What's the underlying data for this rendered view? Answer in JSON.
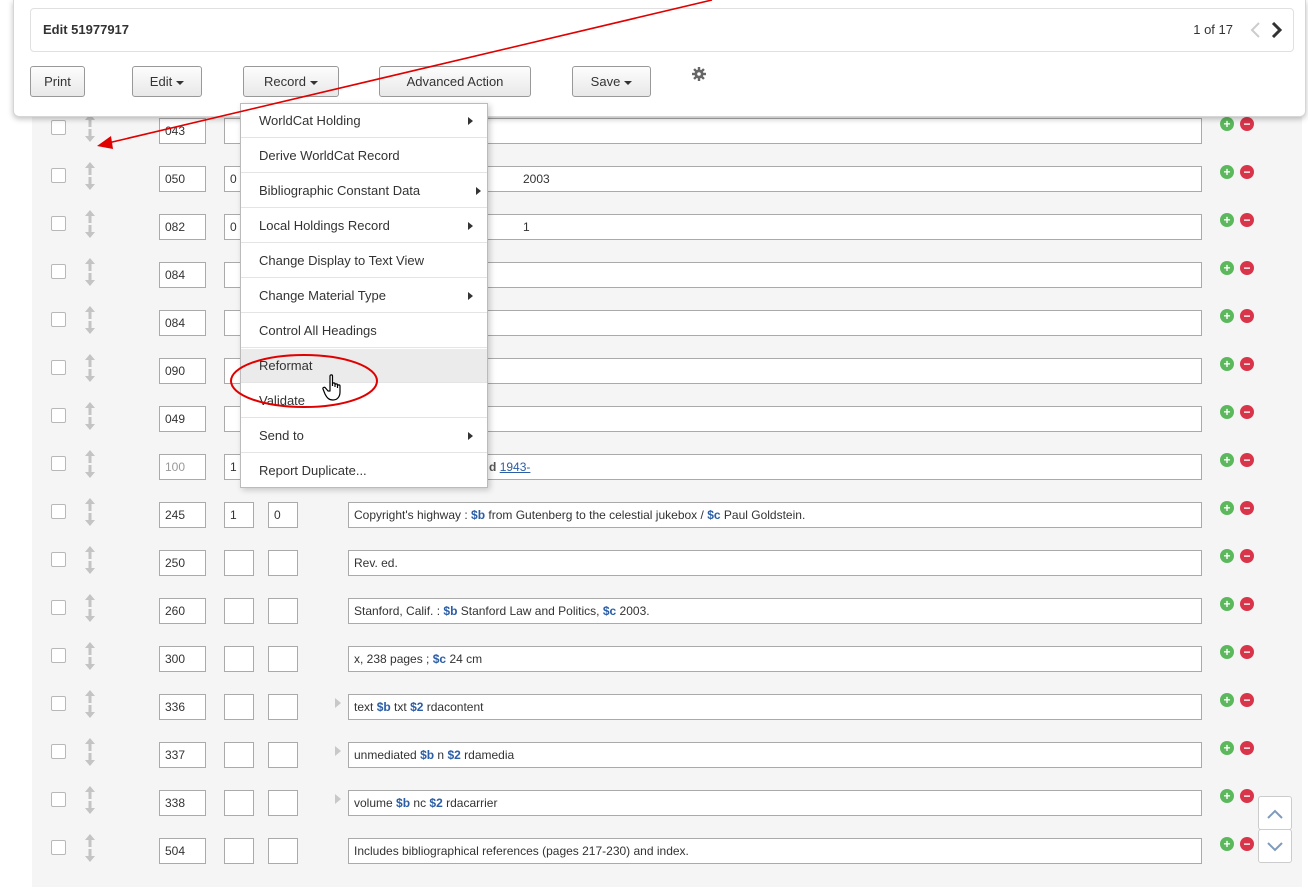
{
  "header": {
    "title": "Edit 51977917",
    "pager": "1 of 17",
    "prev_icon": "chevron-left-icon",
    "next_icon": "chevron-right-icon"
  },
  "toolbar": {
    "print": "Print",
    "edit": "Edit",
    "record": "Record",
    "advanced_action": "Advanced Action",
    "save": "Save",
    "settings_icon": "gear-icon"
  },
  "record_menu": {
    "items": [
      {
        "label": "WorldCat Holding",
        "submenu": true
      },
      {
        "label": "Derive WorldCat Record",
        "submenu": false
      },
      {
        "label": "Bibliographic Constant Data",
        "submenu": true
      },
      {
        "label": "Local Holdings Record",
        "submenu": true
      },
      {
        "label": "Change Display to Text View",
        "submenu": false
      },
      {
        "label": "Change Material Type",
        "submenu": true
      },
      {
        "label": "Control All Headings",
        "submenu": false
      },
      {
        "label": "Reformat",
        "submenu": false,
        "highlighted": true
      },
      {
        "label": "Validate",
        "submenu": false
      },
      {
        "label": "Send to",
        "submenu": true
      },
      {
        "label": "Report Duplicate...",
        "submenu": false
      }
    ]
  },
  "fields": [
    {
      "tag": "043",
      "ind1": "",
      "ind2": "",
      "text": ""
    },
    {
      "tag": "050",
      "ind1": "0",
      "ind2": "",
      "text": "2003"
    },
    {
      "tag": "082",
      "ind1": "0",
      "ind2": "",
      "text": "1"
    },
    {
      "tag": "084",
      "ind1": "",
      "ind2": "",
      "text": ""
    },
    {
      "tag": "084",
      "ind1": "",
      "ind2": "",
      "text": ""
    },
    {
      "tag": "090",
      "ind1": "",
      "ind2": "",
      "text": ""
    },
    {
      "tag": "049",
      "ind1": "",
      "ind2": "",
      "text": ""
    },
    {
      "tag": "100",
      "ind1": "1",
      "ind2": "",
      "text": "d",
      "link": "1943-"
    },
    {
      "tag": "245",
      "ind1": "1",
      "ind2": "0",
      "pre": "Copyright's highway :",
      "sub1": "$b",
      "mid": "from Gutenberg to the celestial jukebox /",
      "sub2": "$c",
      "post": "Paul Goldstein."
    },
    {
      "tag": "250",
      "ind1": "",
      "ind2": "",
      "text": "Rev. ed."
    },
    {
      "tag": "260",
      "ind1": "",
      "ind2": "",
      "pre": "Stanford, Calif. :",
      "sub1": "$b",
      "mid": "Stanford Law and Politics,",
      "sub2": "$c",
      "post": "2003."
    },
    {
      "tag": "300",
      "ind1": "",
      "ind2": "",
      "pre": "x, 238 pages ;",
      "sub1": "$c",
      "mid": "24 cm"
    },
    {
      "tag": "336",
      "ind1": "",
      "ind2": "",
      "pre": "text",
      "sub1": "$b",
      "mid": "txt",
      "sub2": "$2",
      "post": "rdacontent"
    },
    {
      "tag": "337",
      "ind1": "",
      "ind2": "",
      "pre": "unmediated",
      "sub1": "$b",
      "mid": "n",
      "sub2": "$2",
      "post": "rdamedia"
    },
    {
      "tag": "338",
      "ind1": "",
      "ind2": "",
      "pre": "volume",
      "sub1": "$b",
      "mid": "nc",
      "sub2": "$2",
      "post": "rdacarrier"
    },
    {
      "tag": "504",
      "ind1": "",
      "ind2": "",
      "text": "Includes bibliographical references (pages 217-230) and index."
    }
  ],
  "row_controls": {
    "add_symbol": "+",
    "remove_symbol": "−",
    "scroll_up_icon": "chevron-up-icon",
    "scroll_down_icon": "chevron-down-icon"
  },
  "colors": {
    "subfield": "#2b5ea7",
    "add": "#5cb85c",
    "remove": "#d9354a",
    "annotation": "#e00000"
  }
}
